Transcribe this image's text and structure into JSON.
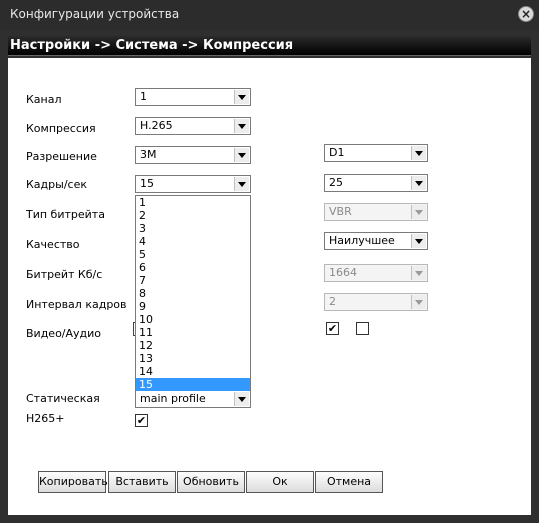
{
  "window": {
    "title": "Конфигурации устройства",
    "close_label": "×"
  },
  "breadcrumb": "Настройки -> Система -> Компрессия",
  "labels": {
    "channel": "Канал",
    "compression": "Компрессия",
    "resolution": "Разрешение",
    "fps": "Кадры/сек",
    "bitrate_type": "Тип битрейта",
    "quality": "Качество",
    "bitrate": "Битрейт Кб/с",
    "frame_interval": "Интервал кадров",
    "video_audio": "Видео/Аудио",
    "static": "Статическая",
    "h265plus": "H265+"
  },
  "main_stream": {
    "channel": "1",
    "compression": "H.265",
    "resolution": "3M",
    "fps": "15",
    "static": "main profile"
  },
  "extra_stream": {
    "resolution": "D1",
    "fps": "25",
    "bitrate_type": "VBR",
    "quality": "Наилучшее",
    "bitrate": "1664",
    "frame_interval": "2"
  },
  "checks": {
    "extra_video": "✔",
    "extra_audio": "",
    "h265plus": "✔"
  },
  "fps_options": [
    "1",
    "2",
    "3",
    "4",
    "5",
    "6",
    "7",
    "8",
    "9",
    "10",
    "11",
    "12",
    "13",
    "14",
    "15"
  ],
  "fps_selected": "15",
  "buttons": {
    "copy": "Копировать",
    "paste": "Вставить",
    "refresh": "Обновить",
    "ok": "Ок",
    "cancel": "Отмена"
  }
}
